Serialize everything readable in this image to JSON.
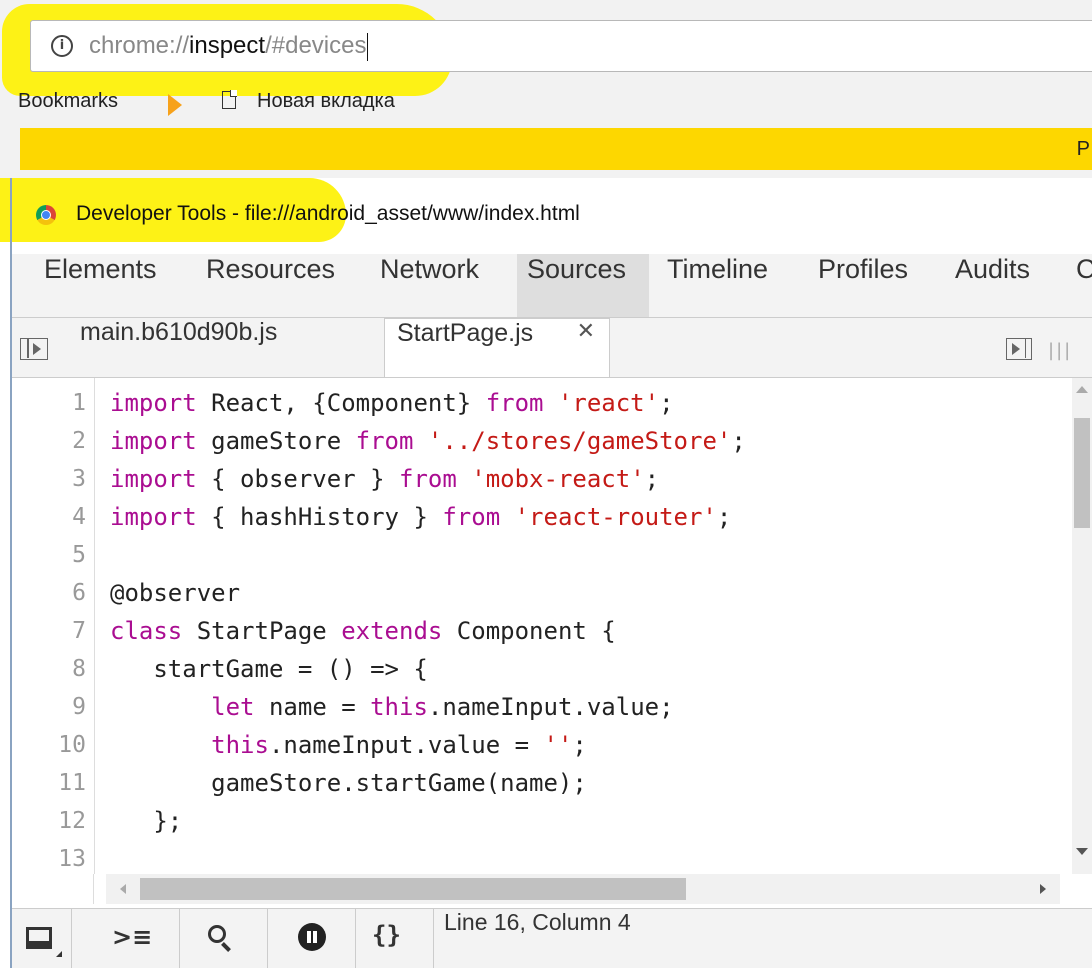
{
  "browser": {
    "url_scheme": "chrome://",
    "url_host": "inspect",
    "url_path": "/#devices",
    "bookmarks_label": "Bookmarks",
    "bookmark_item": "Новая вкладка",
    "infobar_text": "P"
  },
  "devtools": {
    "window_title": "Developer Tools - file:///android_asset/www/index.html",
    "panel_tabs": [
      "Elements",
      "Resources",
      "Network",
      "Sources",
      "Timeline",
      "Profiles",
      "Audits",
      "C"
    ],
    "active_panel": "Sources",
    "file_tabs": [
      {
        "label": "main.b610d90b.js"
      },
      {
        "label": "StartPage.js",
        "close": "✕"
      }
    ],
    "status": "Line 16, Column 4",
    "code_lines": [
      {
        "n": "1",
        "parts": [
          [
            "kw",
            "import"
          ],
          [
            "",
            "  React, {Component} "
          ],
          [
            "kw",
            "from"
          ],
          [
            "",
            ""
          ],
          [
            "str",
            "'react'"
          ],
          [
            "",
            ";"
          ]
        ]
      },
      {
        "n": "2",
        "parts": [
          [
            "kw",
            "import"
          ],
          [
            "",
            "  gameStore "
          ],
          [
            "kw",
            "from"
          ],
          [
            "",
            ""
          ],
          [
            "str",
            "'../stores/gameStore'"
          ],
          [
            "",
            ";"
          ]
        ]
      },
      {
        "n": "3",
        "parts": [
          [
            "kw",
            "import"
          ],
          [
            "",
            "  { observer } "
          ],
          [
            "kw",
            "from"
          ],
          [
            "",
            ""
          ],
          [
            "str",
            "'mobx-react'"
          ],
          [
            "",
            ";"
          ]
        ]
      },
      {
        "n": "4",
        "parts": [
          [
            "kw",
            "import"
          ],
          [
            "",
            "  { hashHistory } "
          ],
          [
            "kw",
            "from"
          ],
          [
            "",
            ""
          ],
          [
            "str",
            "'react-router'"
          ],
          [
            "",
            ";"
          ]
        ]
      },
      {
        "n": "5",
        "parts": []
      },
      {
        "n": "6",
        "parts": [
          [
            "dec",
            "@observer"
          ]
        ]
      },
      {
        "n": "7",
        "parts": [
          [
            "kw",
            "class"
          ],
          [
            "",
            " StartPage "
          ],
          [
            "kw",
            "extends"
          ],
          [
            "",
            " Component {"
          ]
        ]
      },
      {
        "n": "8",
        "parts": [
          [
            "",
            "    startGame = () => {"
          ]
        ]
      },
      {
        "n": "9",
        "parts": [
          [
            "",
            "        "
          ],
          [
            "kw",
            "let"
          ],
          [
            "",
            " name = "
          ],
          [
            "kw",
            "this"
          ],
          [
            "",
            ".nameInput.value;"
          ]
        ]
      },
      {
        "n": "10",
        "parts": [
          [
            "",
            "        "
          ],
          [
            "kw",
            "this"
          ],
          [
            "",
            ".nameInput.value = "
          ],
          [
            "str",
            "''"
          ],
          [
            "",
            ";"
          ]
        ]
      },
      {
        "n": "11",
        "parts": [
          [
            "",
            "        gameStore.startGame(name);"
          ]
        ]
      },
      {
        "n": "12",
        "parts": [
          [
            "",
            "    };"
          ]
        ]
      },
      {
        "n": "13",
        "parts": []
      }
    ]
  }
}
